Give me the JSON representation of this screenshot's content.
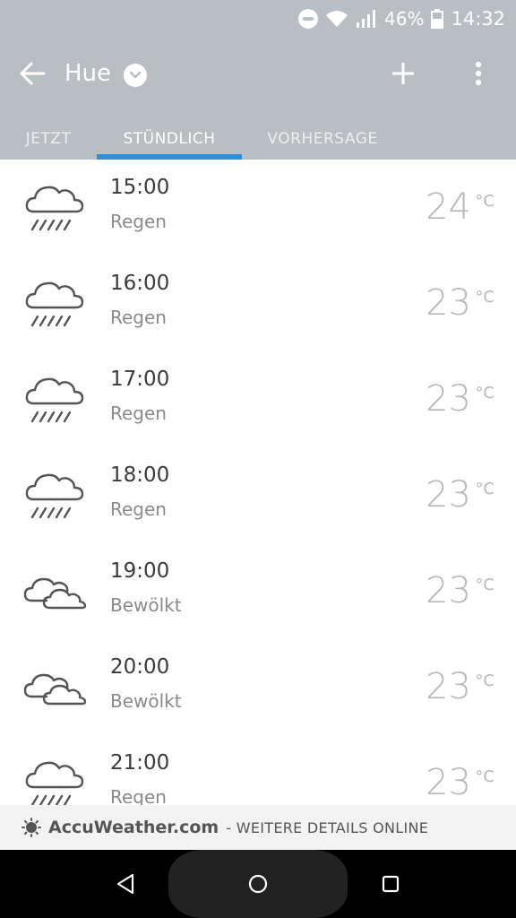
{
  "status_bar": {
    "battery": "46%",
    "time": "14:32"
  },
  "app_bar": {
    "title": "Hue",
    "tabs": [
      {
        "label": "JETZT",
        "active": false
      },
      {
        "label": "STÜNDLICH",
        "active": true
      },
      {
        "label": "VORHERSAGE",
        "active": false
      }
    ]
  },
  "hourly": [
    {
      "time": "15:00",
      "condition": "Regen",
      "temp": "24",
      "unit": "°C",
      "icon": "rain-cloud-icon"
    },
    {
      "time": "16:00",
      "condition": "Regen",
      "temp": "23",
      "unit": "°C",
      "icon": "rain-cloud-icon"
    },
    {
      "time": "17:00",
      "condition": "Regen",
      "temp": "23",
      "unit": "°C",
      "icon": "rain-cloud-icon"
    },
    {
      "time": "18:00",
      "condition": "Regen",
      "temp": "23",
      "unit": "°C",
      "icon": "rain-cloud-icon"
    },
    {
      "time": "19:00",
      "condition": "Bewölkt",
      "temp": "23",
      "unit": "°C",
      "icon": "cloudy-icon"
    },
    {
      "time": "20:00",
      "condition": "Bewölkt",
      "temp": "23",
      "unit": "°C",
      "icon": "cloudy-icon"
    },
    {
      "time": "21:00",
      "condition": "Regen",
      "temp": "23",
      "unit": "°C",
      "icon": "rain-cloud-icon"
    }
  ],
  "footer": {
    "brand": "AccuWeather.com",
    "more": "- WEITERE DETAILS ONLINE"
  },
  "colors": {
    "header_bg": "#b9bec2",
    "tab_indicator": "#2a91d8"
  }
}
